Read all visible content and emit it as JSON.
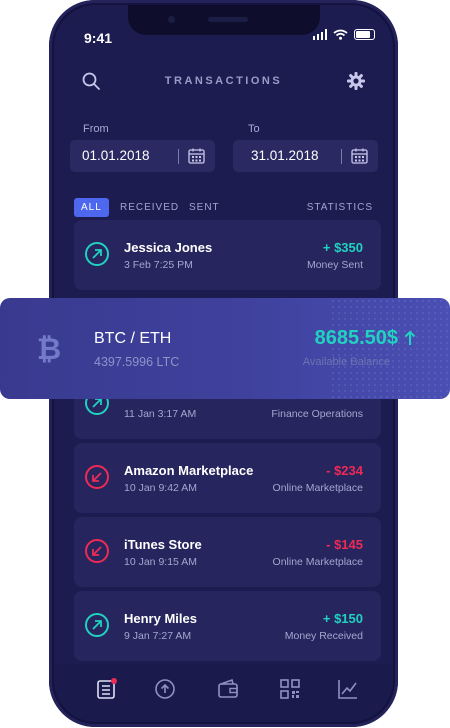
{
  "status_bar": {
    "time": "9:41"
  },
  "header": {
    "title": "TRANSACTIONS",
    "search_icon": "search-icon",
    "settings_icon": "gear-icon"
  },
  "date_range": {
    "from_label": "From",
    "from_value": "01.01.2018",
    "to_label": "To",
    "to_value": "31.01.2018"
  },
  "tabs": {
    "all": "ALL",
    "received": "RECEIVED",
    "sent": "SENT",
    "statistics": "STATISTICS"
  },
  "transactions": [
    {
      "name": "Jessica Jones",
      "date": "3 Feb 7:25 PM",
      "amount": "+ $350",
      "type": "Money Sent",
      "direction": "out"
    },
    {
      "name": "",
      "date": "11 Jan 3:17 AM",
      "amount": "",
      "type": "Finance Operations",
      "direction": "out"
    },
    {
      "name": "Amazon Marketplace",
      "date": "10 Jan 9:42 AM",
      "amount": "- $234",
      "type": "Online Marketplace",
      "direction": "in"
    },
    {
      "name": "iTunes Store",
      "date": "10 Jan 9:15 AM",
      "amount": "- $145",
      "type": "Online Marketplace",
      "direction": "in"
    },
    {
      "name": "Henry Miles",
      "date": "9 Jan 7:27 AM",
      "amount": "+ $150",
      "type": "Money Received",
      "direction": "out"
    }
  ],
  "balance_card": {
    "pair": "BTC / ETH",
    "secondary": "4397.5996 LTC",
    "balance": "8685.50$",
    "balance_label": "Available Balance"
  },
  "colors": {
    "accent": "#4d67ee",
    "positive": "#21d2c0",
    "negative": "#ef2a55",
    "background": "#1d1c50",
    "card": "#26255e"
  },
  "bottom_nav": [
    "list-icon",
    "upload-icon",
    "wallet-icon",
    "qr-code-icon",
    "chart-icon"
  ]
}
